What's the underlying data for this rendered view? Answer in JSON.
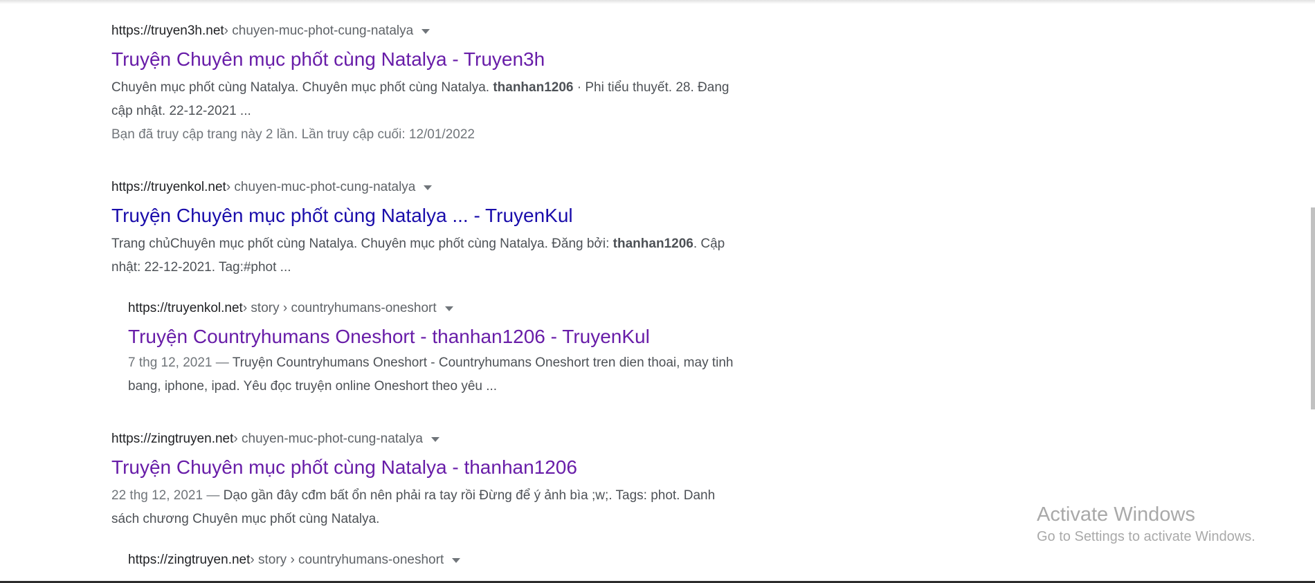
{
  "results": [
    {
      "site": "https://truyen3h.net",
      "path": " › chuyen-muc-phot-cung-natalya",
      "title": "Truyện Chuyên mục phốt cùng Natalya - Truyen3h",
      "snippet": {
        "part1": "Chuyên mục phốt cùng Natalya. Chuyên mục phốt cùng Natalya. ",
        "bold1": "thanhan1206",
        "part2": " · Phi tiểu thuyết. 28. Đang cập nhật. 22-12-2021 ..."
      },
      "visit_note": "Bạn đã truy cập trang này 2 lần. Lần truy cập cuối: 12/01/2022"
    },
    {
      "site": "https://truyenkol.net",
      "path": " › chuyen-muc-phot-cung-natalya",
      "title": "Truyện Chuyên mục phốt cùng Natalya ... - TruyenKul",
      "snippet": {
        "part1": "Trang chủChuyên mục phốt cùng Natalya. Chuyên mục phốt cùng Natalya. Đăng bởi: ",
        "bold1": "thanhan1206",
        "part2": ". Cập nhật: 22-12-2021. Tag:#phot ..."
      }
    },
    {
      "site": "https://truyenkol.net",
      "path": " › story › countryhumans-oneshort",
      "title": "Truyện Countryhumans Oneshort - thanhan1206 - TruyenKul",
      "snippet": {
        "date": "7 thg 12, 2021 — ",
        "text": "Truyện Countryhumans Oneshort - Countryhumans Oneshort tren dien thoai, may tinh bang, iphone, ipad. Yêu đọc truyện online Oneshort theo yêu ..."
      }
    },
    {
      "site": "https://zingtruyen.net",
      "path": " › chuyen-muc-phot-cung-natalya",
      "title": "Truyện Chuyên mục phốt cùng Natalya - thanhan1206",
      "snippet": {
        "date": "22 thg 12, 2021 — ",
        "text": "Dạo gần đây cđm bất ổn nên phải ra tay rồi Đừng để ý ảnh bìa ;w;. Tags: phot. Danh sách chương Chuyên mục phốt cùng Natalya."
      }
    },
    {
      "site": "https://zingtruyen.net",
      "path": " › story › countryhumans-oneshort"
    }
  ],
  "watermark": {
    "line1": "Activate Windows",
    "line2": "Go to Settings to activate Windows."
  },
  "colors": {
    "link_visited": "#681da8",
    "link_unvisited": "#1a0dab",
    "snippet_text": "#4d5156",
    "meta_text": "#70757a"
  }
}
